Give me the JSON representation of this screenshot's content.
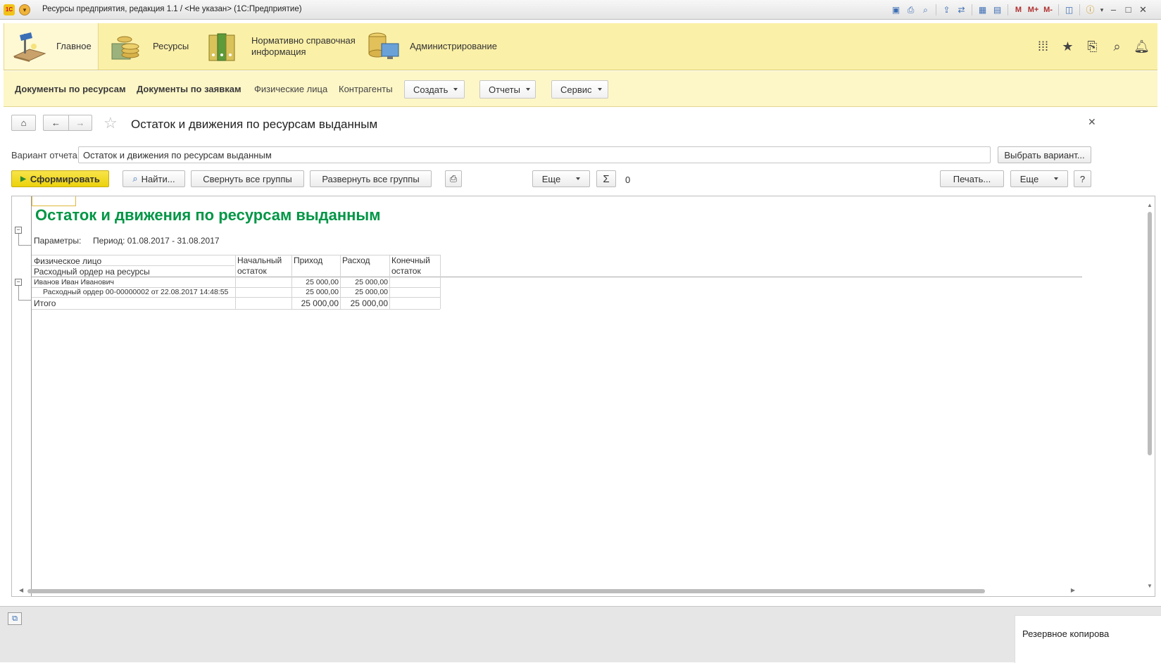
{
  "window": {
    "title": "Ресурсы предприятия, редакция 1.1 / <Не указан>  (1С:Предприятие)",
    "logo_text": "1С",
    "toolbar_m": [
      "M",
      "M+",
      "M-"
    ]
  },
  "sections": [
    {
      "label": "Главное",
      "icon": "desk-lamp-icon",
      "active": true
    },
    {
      "label": "Ресурсы",
      "icon": "coins-icon",
      "active": false
    },
    {
      "label": "Нормативно справочная\nинформация",
      "icon": "binders-icon",
      "active": false
    },
    {
      "label": "Администрирование",
      "icon": "database-computer-icon",
      "active": false
    }
  ],
  "subnav": {
    "links": [
      "Документы по ресурсам",
      "Документы по заявкам",
      "Физические лица",
      "Контрагенты"
    ],
    "menus": [
      "Создать",
      "Отчеты",
      "Сервис"
    ]
  },
  "form": {
    "title": "Остаток и движения по ресурсам выданным",
    "variant_label": "Вариант отчета:",
    "variant_value": "Остаток и движения по ресурсам выданным",
    "choose_variant": "Выбрать вариант...",
    "generate": "Сформировать",
    "find": "Найти...",
    "collapse_all": "Свернуть все группы",
    "expand_all": "Развернуть все группы",
    "more": "Еще",
    "sum_value": "0",
    "print": "Печать...",
    "more2": "Еще",
    "help": "?"
  },
  "report": {
    "title": "Остаток и движения по ресурсам выданным",
    "params_label": "Параметры:",
    "period": "Период: 01.08.2017 - 31.08.2017",
    "headers": {
      "col1_line1": "Физическое лицо",
      "col1_line2": "Расходный ордер на ресурсы",
      "col2": "Начальный\nостаток",
      "col3": "Приход",
      "col4": "Расход",
      "col5": "Конечный\nостаток"
    },
    "rows": [
      {
        "name": "Иванов Иван Иванович",
        "start": "",
        "in": "25 000,00",
        "out": "25 000,00",
        "end": ""
      },
      {
        "name": "Расходный ордер 00-00000002 от 22.08.2017 14:48:55",
        "start": "",
        "in": "25 000,00",
        "out": "25 000,00",
        "end": ""
      }
    ],
    "total": {
      "name": "Итого",
      "start": "",
      "in": "25 000,00",
      "out": "25 000,00",
      "end": ""
    }
  },
  "statusbar": {
    "notification": "Резервное копирова"
  },
  "colors": {
    "section_bg": "#fbf0a7",
    "report_title": "#009646",
    "primary_button": "#ecd20c"
  }
}
